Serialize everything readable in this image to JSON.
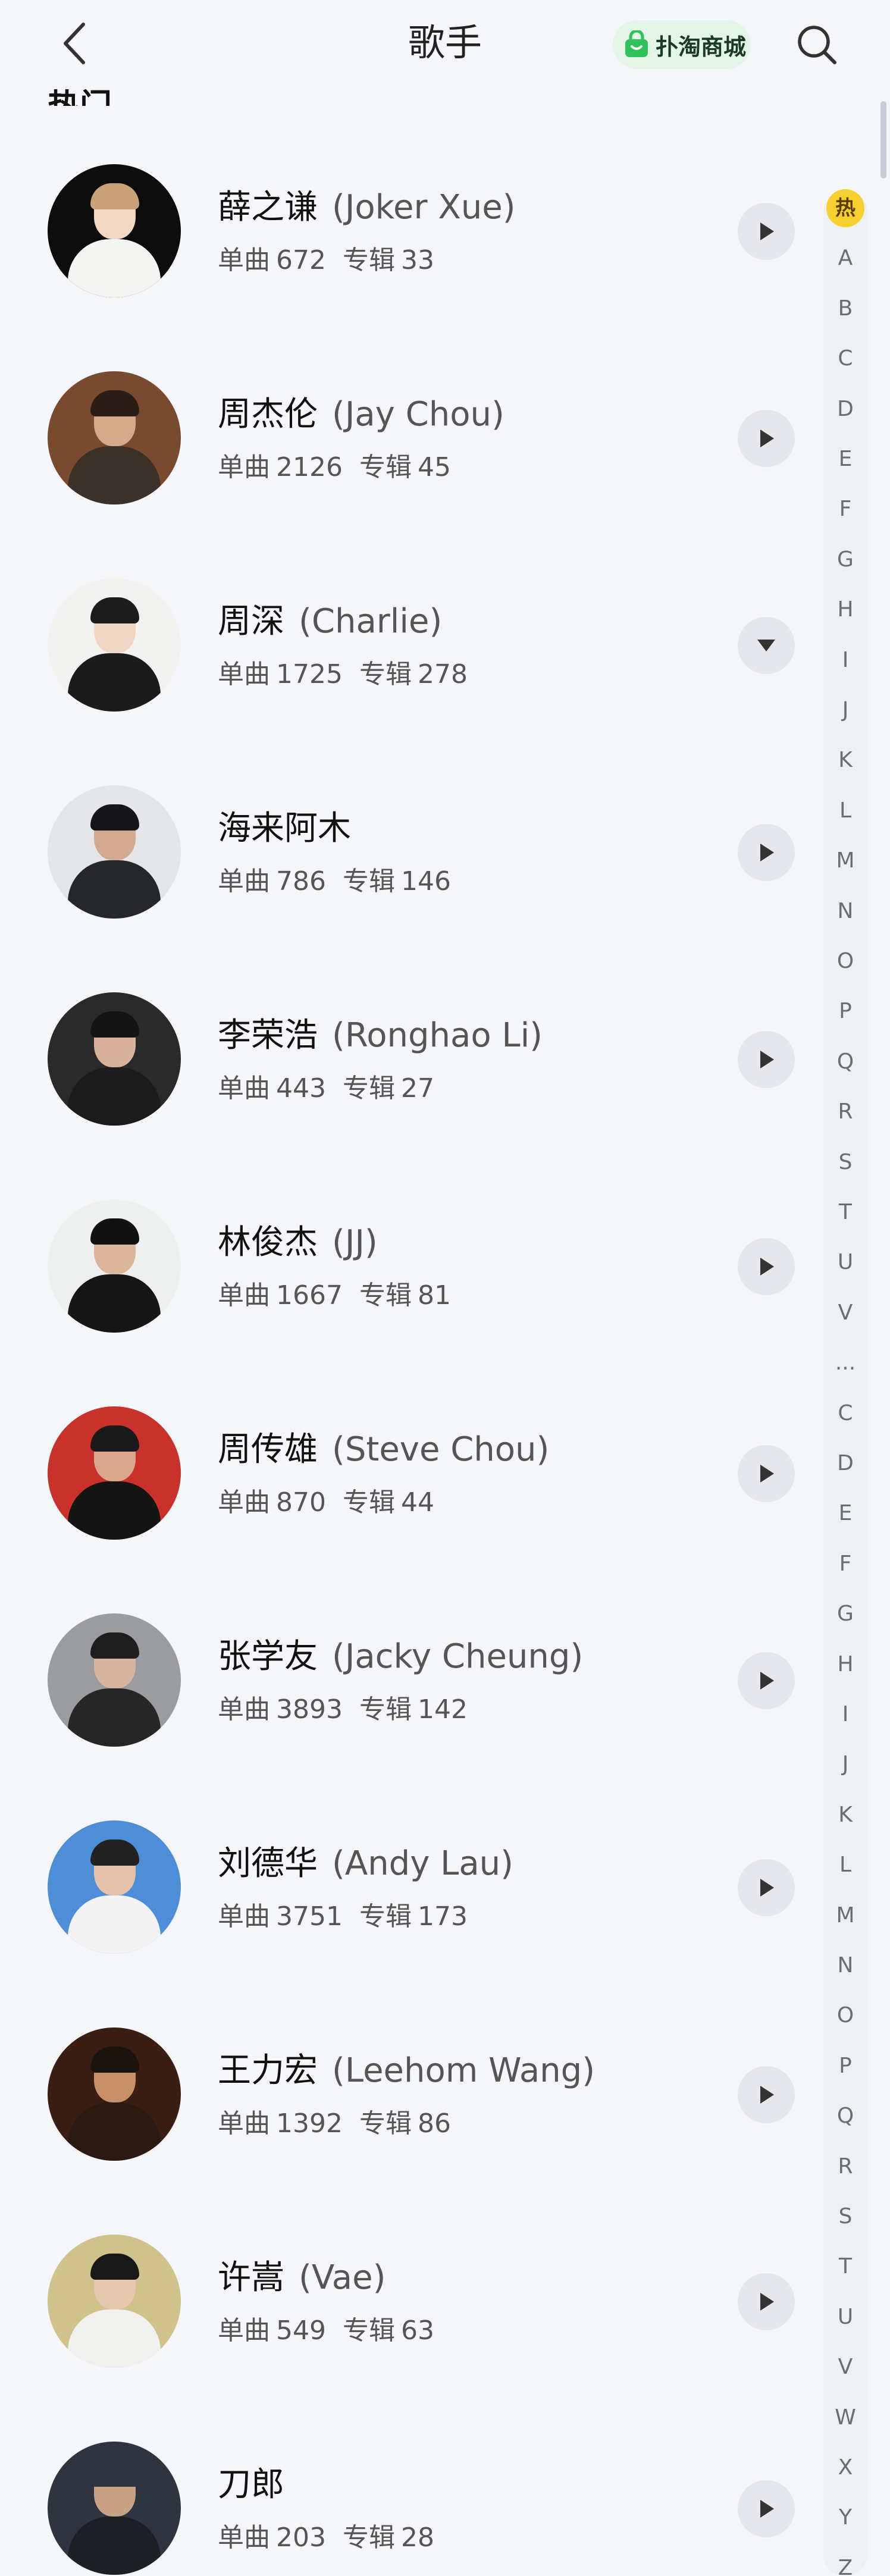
{
  "header": {
    "title": "歌手",
    "shop_label": "扑淘商城"
  },
  "section": {
    "label": "热门"
  },
  "artists": [
    {
      "name": "薛之谦",
      "en": "(Joker Xue)",
      "singles_label": "单曲",
      "singles": "672",
      "albums_label": "专辑",
      "albums": "33",
      "button": "play",
      "colors": {
        "bg": "#0d0d0d",
        "hair": "#c9a27a",
        "skin": "#f1d8c4",
        "body": "#f4f4f2"
      }
    },
    {
      "name": "周杰伦",
      "en": "(Jay Chou)",
      "singles_label": "单曲",
      "singles": "2126",
      "albums_label": "专辑",
      "albums": "45",
      "button": "play",
      "colors": {
        "bg": "#7a4a2e",
        "hair": "#2b1e17",
        "skin": "#d6a98a",
        "body": "#3b3129"
      }
    },
    {
      "name": "周深",
      "en": "(Charlie)",
      "singles_label": "单曲",
      "singles": "1725",
      "albums_label": "专辑",
      "albums": "278",
      "button": "dropdown",
      "colors": {
        "bg": "#f2f2f0",
        "hair": "#1c1c1c",
        "skin": "#efd5c4",
        "body": "#1b1b1b"
      }
    },
    {
      "name": "海来阿木",
      "en": "",
      "singles_label": "单曲",
      "singles": "786",
      "albums_label": "专辑",
      "albums": "146",
      "button": "play",
      "colors": {
        "bg": "#e4e6ea",
        "hair": "#15151a",
        "skin": "#d3aa90",
        "body": "#26272b"
      }
    },
    {
      "name": "李荣浩",
      "en": "(Ronghao Li)",
      "singles_label": "单曲",
      "singles": "443",
      "albums_label": "专辑",
      "albums": "27",
      "button": "play",
      "colors": {
        "bg": "#2a2a2a",
        "hair": "#141414",
        "skin": "#d8b29a",
        "body": "#1c1c1c"
      }
    },
    {
      "name": "林俊杰",
      "en": "(JJ)",
      "singles_label": "单曲",
      "singles": "1667",
      "albums_label": "专辑",
      "albums": "81",
      "button": "play",
      "colors": {
        "bg": "#eef0f0",
        "hair": "#111111",
        "skin": "#dcb69b",
        "body": "#161616"
      }
    },
    {
      "name": "周传雄",
      "en": "(Steve Chou)",
      "singles_label": "单曲",
      "singles": "870",
      "albums_label": "专辑",
      "albums": "44",
      "button": "play",
      "colors": {
        "bg": "#c9322a",
        "hair": "#1a1a1a",
        "skin": "#d9a88c",
        "body": "#141414"
      }
    },
    {
      "name": "张学友",
      "en": "(Jacky Cheung)",
      "singles_label": "单曲",
      "singles": "3893",
      "albums_label": "专辑",
      "albums": "142",
      "button": "play",
      "colors": {
        "bg": "#9a9ca0",
        "hair": "#1e1e1e",
        "skin": "#d8b49e",
        "body": "#262626"
      }
    },
    {
      "name": "刘德华",
      "en": "(Andy Lau)",
      "singles_label": "单曲",
      "singles": "3751",
      "albums_label": "专辑",
      "albums": "173",
      "button": "play",
      "colors": {
        "bg": "#4d8ed6",
        "hair": "#222222",
        "skin": "#e4c1a8",
        "body": "#f3f3f3"
      }
    },
    {
      "name": "王力宏",
      "en": "(Leehom Wang)",
      "singles_label": "单曲",
      "singles": "1392",
      "albums_label": "专辑",
      "albums": "86",
      "button": "play",
      "colors": {
        "bg": "#3a1e14",
        "hair": "#1a1410",
        "skin": "#c89067",
        "body": "#2a1a12"
      }
    },
    {
      "name": "许嵩",
      "en": "(Vae)",
      "singles_label": "单曲",
      "singles": "549",
      "albums_label": "专辑",
      "albums": "63",
      "button": "play",
      "colors": {
        "bg": "#cfc28a",
        "hair": "#181818",
        "skin": "#e6c7b0",
        "body": "#f0f0ee"
      }
    },
    {
      "name": "刀郎",
      "en": "",
      "singles_label": "单曲",
      "singles": "203",
      "albums_label": "专辑",
      "albums": "28",
      "button": "play",
      "colors": {
        "bg": "#2f3540",
        "hair": "#2f3540",
        "skin": "#c9a184",
        "body": "#1d1f24"
      }
    }
  ],
  "alpha_index": [
    {
      "label": "热",
      "hot": true
    },
    {
      "label": "A"
    },
    {
      "label": "B"
    },
    {
      "label": "C"
    },
    {
      "label": "D"
    },
    {
      "label": "E"
    },
    {
      "label": "F"
    },
    {
      "label": "G"
    },
    {
      "label": "H"
    },
    {
      "label": "I"
    },
    {
      "label": "J"
    },
    {
      "label": "K"
    },
    {
      "label": "L"
    },
    {
      "label": "M"
    },
    {
      "label": "N"
    },
    {
      "label": "O"
    },
    {
      "label": "P"
    },
    {
      "label": "Q"
    },
    {
      "label": "R"
    },
    {
      "label": "S"
    },
    {
      "label": "T"
    },
    {
      "label": "U"
    },
    {
      "label": "V"
    },
    {
      "label": "..."
    },
    {
      "label": "C"
    },
    {
      "label": "D"
    },
    {
      "label": "E"
    },
    {
      "label": "F"
    },
    {
      "label": "G"
    },
    {
      "label": "H"
    },
    {
      "label": "I"
    },
    {
      "label": "J"
    },
    {
      "label": "K"
    },
    {
      "label": "L"
    },
    {
      "label": "M"
    },
    {
      "label": "N"
    },
    {
      "label": "O"
    },
    {
      "label": "P"
    },
    {
      "label": "Q"
    },
    {
      "label": "R"
    },
    {
      "label": "S"
    },
    {
      "label": "T"
    },
    {
      "label": "U"
    },
    {
      "label": "V"
    },
    {
      "label": "W"
    },
    {
      "label": "X"
    },
    {
      "label": "Y"
    },
    {
      "label": "Z"
    }
  ],
  "colors": {
    "accent_hot": "#f7cf2e",
    "shop_bg": "#e2f5e6",
    "shop_icon": "#2fc25b"
  }
}
